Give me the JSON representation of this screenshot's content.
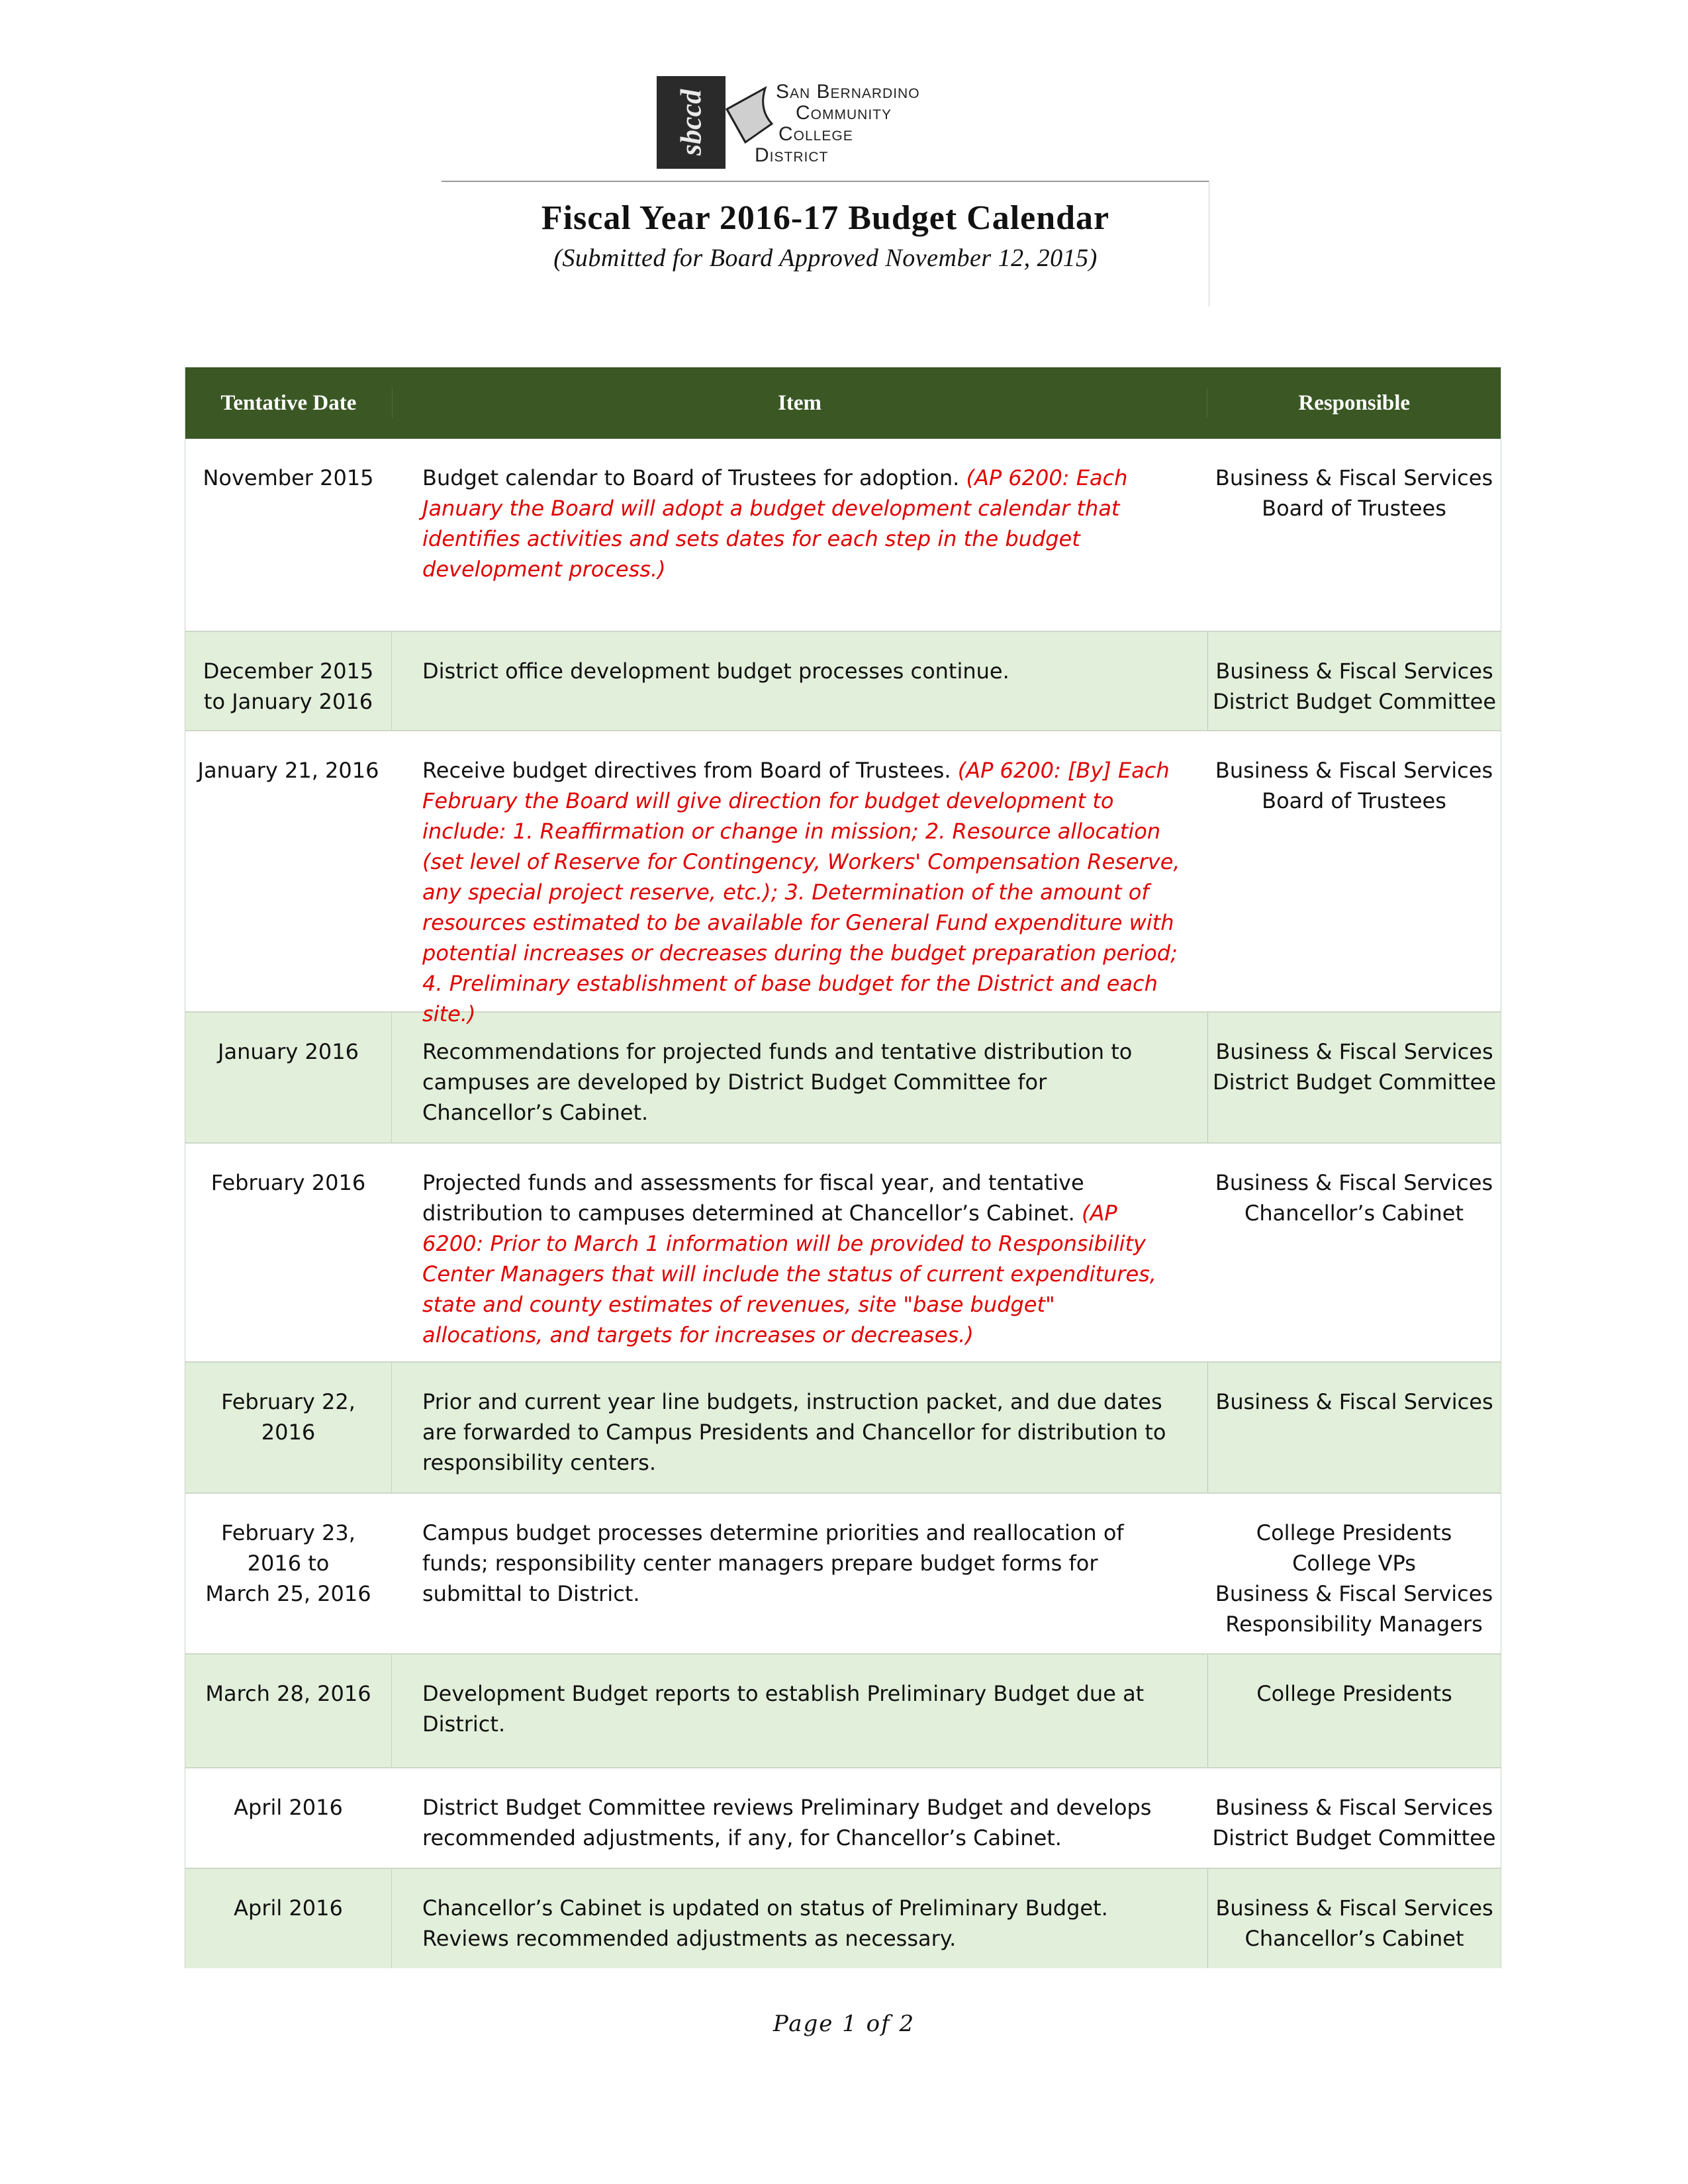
{
  "logo": {
    "mark": "sbccd",
    "lines": [
      "San Bernardino",
      "Community",
      "College",
      "District"
    ]
  },
  "header": {
    "title": "Fiscal Year 2016-17 Budget Calendar",
    "subtitle": "(Submitted for Board Approved November 12, 2015)"
  },
  "table": {
    "header_color": "#3a5724",
    "alt_row_color": "#e2efda",
    "note_color": "#e00000",
    "columns": [
      "Tentative Date",
      "Item",
      "Responsible"
    ],
    "rows": [
      {
        "date": [
          "November  2015"
        ],
        "item": "Budget calendar to Board of Trustees for adoption.",
        "note": "(AP 6200:  Each January the Board will adopt a budget development calendar that identifies activities and sets dates for each step in the budget development process.)",
        "responsible": [
          "Business & Fiscal Services",
          "Board of Trustees"
        ]
      },
      {
        "date": [
          "December 2015",
          "to January 2016"
        ],
        "item": "District office development budget processes continue.",
        "note": "",
        "responsible": [
          "Business & Fiscal Services",
          "District Budget Committee"
        ]
      },
      {
        "date": [
          "January 21, 2016"
        ],
        "item": "Receive budget directives from Board of Trustees.",
        "note": "(AP 6200:  [By] Each February the Board will give direction for budget development to include: 1. Reaffirmation or change in mission; 2. Resource allocation (set level of Reserve for Contingency, Workers' Compensation Reserve, any special project reserve, etc.); 3. Determination of the amount of resources estimated to be available for General Fund expenditure with potential increases or decreases during the budget preparation period; 4. Preliminary establishment of base budget for the District and each site.)",
        "responsible": [
          "Business & Fiscal Services",
          "Board of Trustees"
        ]
      },
      {
        "date": [
          "January 2016"
        ],
        "item": "Recommendations for projected funds and tentative distribution to campuses are developed by District Budget Committee for Chancellor’s Cabinet.",
        "note": "",
        "responsible": [
          "Business & Fiscal Services",
          "District Budget Committee"
        ]
      },
      {
        "date": [
          "February 2016"
        ],
        "item": "Projected funds and assessments for fiscal year, and tentative distribution to campuses determined at Chancellor’s Cabinet.",
        "note": "(AP 6200: Prior to March 1 information will be provided to Responsibility Center Managers that will include the status of current expenditures, state and county estimates of revenues, site \"base budget\" allocations, and targets for increases or decreases.)",
        "responsible": [
          "Business & Fiscal Services",
          "Chancellor’s Cabinet"
        ]
      },
      {
        "date": [
          "February 22,",
          "2016"
        ],
        "item": "Prior and current year line budgets, instruction packet, and due dates are forwarded to Campus Presidents and Chancellor for distribution to responsibility centers.",
        "note": "",
        "responsible": [
          "Business & Fiscal Services"
        ]
      },
      {
        "date": [
          "February 23,",
          "2016 to",
          "March 25, 2016"
        ],
        "item": "Campus budget processes determine priorities and reallocation of funds; responsibility center managers prepare budget forms for submittal to District.",
        "note": "",
        "responsible": [
          "College Presidents",
          "College VPs",
          "Business & Fiscal Services",
          "Responsibility Managers"
        ]
      },
      {
        "date": [
          "March 28, 2016"
        ],
        "item": "Development Budget reports to establish Preliminary Budget due at District.",
        "note": "",
        "responsible": [
          "College Presidents"
        ]
      },
      {
        "date": [
          "April 2016"
        ],
        "item": "District Budget Committee reviews Preliminary Budget and develops recommended adjustments, if any, for Chancellor’s Cabinet.",
        "note": "",
        "responsible": [
          "Business & Fiscal Services",
          "District Budget Committee"
        ]
      },
      {
        "date": [
          "April 2016"
        ],
        "item": "Chancellor’s Cabinet is updated on status of Preliminary Budget.  Reviews recommended adjustments as necessary.",
        "note": "",
        "responsible": [
          "Business & Fiscal Services",
          "Chancellor’s Cabinet"
        ]
      }
    ]
  },
  "footer": {
    "page_label": "Page 1 of 2"
  }
}
